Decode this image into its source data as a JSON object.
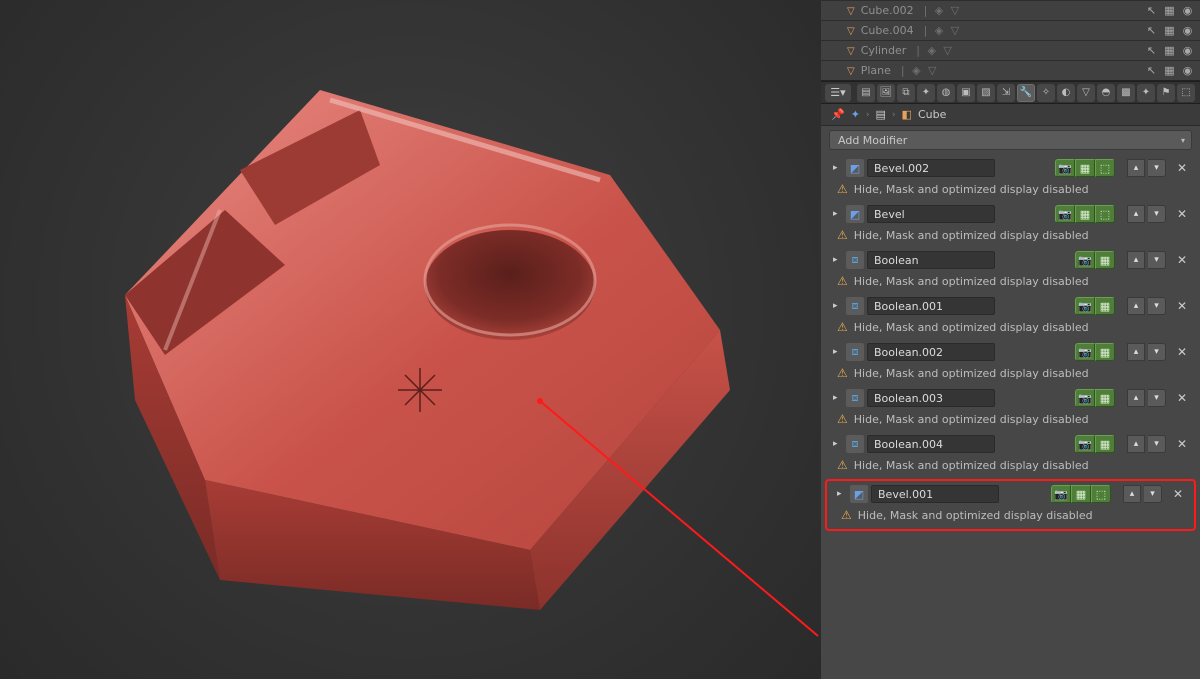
{
  "outliner": {
    "rows": [
      {
        "name": "Cube.002"
      },
      {
        "name": "Cube.004"
      },
      {
        "name": "Cylinder"
      },
      {
        "name": "Plane"
      }
    ]
  },
  "breadcrumb": {
    "object": "Cube"
  },
  "props": {
    "add_modifier_label": "Add Modifier",
    "warning_text": "Hide, Mask and optimized display disabled",
    "modifiers": [
      {
        "type": "bevel",
        "name": "Bevel.002",
        "extra_edit_toggle": true
      },
      {
        "type": "bevel",
        "name": "Bevel",
        "extra_edit_toggle": true
      },
      {
        "type": "boolean",
        "name": "Boolean",
        "extra_edit_toggle": false
      },
      {
        "type": "boolean",
        "name": "Boolean.001",
        "extra_edit_toggle": false
      },
      {
        "type": "boolean",
        "name": "Boolean.002",
        "extra_edit_toggle": false
      },
      {
        "type": "boolean",
        "name": "Boolean.003",
        "extra_edit_toggle": false
      },
      {
        "type": "boolean",
        "name": "Boolean.004",
        "extra_edit_toggle": false
      },
      {
        "type": "bevel",
        "name": "Bevel.001",
        "extra_edit_toggle": true,
        "highlight": true
      }
    ]
  }
}
